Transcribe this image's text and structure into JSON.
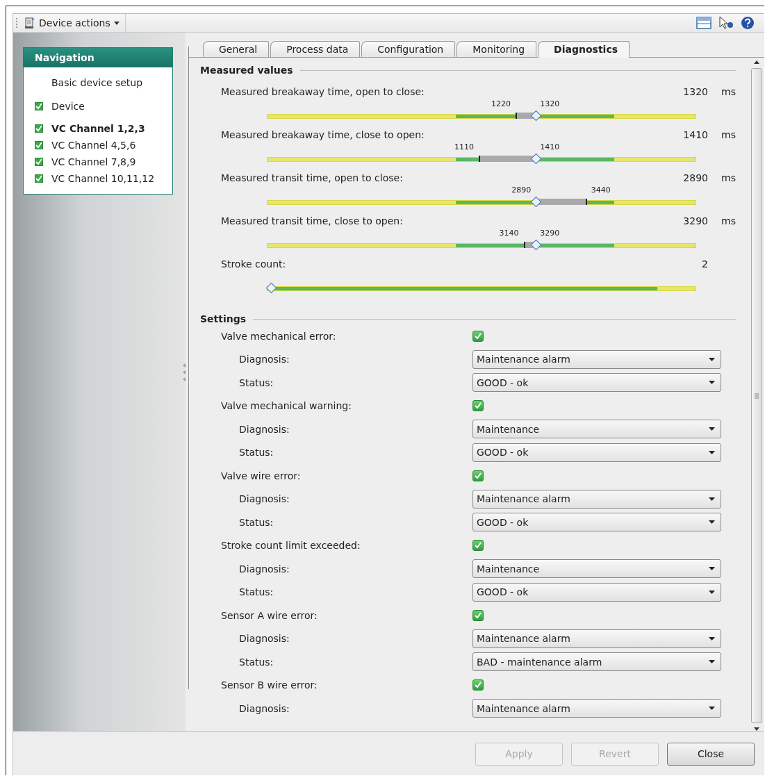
{
  "toolbar": {
    "device_actions": "Device actions"
  },
  "navigation": {
    "title": "Navigation",
    "items": [
      {
        "label": "Basic device setup",
        "kind": "plain",
        "selected": false
      },
      {
        "label": "Device",
        "kind": "check",
        "checked": true,
        "selected": false
      },
      {
        "label": "VC Channel 1,2,3",
        "kind": "check",
        "checked": true,
        "selected": true
      },
      {
        "label": "VC Channel 4,5,6",
        "kind": "check",
        "checked": true,
        "selected": false
      },
      {
        "label": "VC Channel 7,8,9",
        "kind": "check",
        "checked": true,
        "selected": false
      },
      {
        "label": "VC Channel 10,11,12",
        "kind": "check",
        "checked": true,
        "selected": false
      }
    ]
  },
  "tabs": [
    {
      "label": "General",
      "selected": false
    },
    {
      "label": "Process data",
      "selected": false
    },
    {
      "label": "Configuration",
      "selected": false
    },
    {
      "label": "Monitoring",
      "selected": false
    },
    {
      "label": "Diagnostics",
      "selected": true
    }
  ],
  "measured_values": {
    "title": "Measured values",
    "items": [
      {
        "kind": "range",
        "label": "Measured breakaway time, open to close:",
        "value": "1320",
        "unit": "ms",
        "level": 0.627,
        "range_from": "1220",
        "range_to": "1320"
      },
      {
        "kind": "range",
        "label": "Measured breakaway time, close to open:",
        "value": "1410",
        "unit": "ms",
        "level": 0.627,
        "range_from": "1110",
        "range_to": "1410"
      },
      {
        "kind": "range",
        "label": "Measured transit time, open to close:",
        "value": "2890",
        "unit": "ms",
        "level": 0.627,
        "range_from": "2890",
        "range_to": "3440"
      },
      {
        "kind": "range",
        "label": "Measured transit time, close to open:",
        "value": "3290",
        "unit": "ms",
        "level": 0.627,
        "range_from": "3140",
        "range_to": "3290"
      },
      {
        "kind": "count",
        "label": "Stroke count:",
        "value": "2",
        "level": 0
      }
    ]
  },
  "settings": {
    "title": "Settings",
    "items": [
      {
        "label": "Valve mechanical error:",
        "checked": true,
        "fields": [
          {
            "label": "Diagnosis:",
            "value": "Maintenance alarm"
          },
          {
            "label": "Status:",
            "value": "GOOD - ok"
          }
        ]
      },
      {
        "label": "Valve mechanical warning:",
        "checked": true,
        "fields": [
          {
            "label": "Diagnosis:",
            "value": "Maintenance"
          },
          {
            "label": "Status:",
            "value": "GOOD - ok"
          }
        ]
      },
      {
        "label": "Valve wire error:",
        "checked": true,
        "fields": [
          {
            "label": "Diagnosis:",
            "value": "Maintenance alarm"
          },
          {
            "label": "Status:",
            "value": "GOOD - ok"
          }
        ]
      },
      {
        "label": "Stroke count limit exceeded:",
        "checked": true,
        "fields": [
          {
            "label": "Diagnosis:",
            "value": "Maintenance"
          },
          {
            "label": "Status:",
            "value": "GOOD - ok"
          }
        ]
      },
      {
        "label": "Sensor A wire error:",
        "checked": true,
        "fields": [
          {
            "label": "Diagnosis:",
            "value": "Maintenance alarm"
          },
          {
            "label": "Status:",
            "value": "BAD - maintenance alarm"
          }
        ]
      },
      {
        "label": "Sensor B wire error:",
        "checked": true,
        "fields": [
          {
            "label": "Diagnosis:",
            "value": "Maintenance alarm"
          }
        ]
      }
    ]
  },
  "buttons": [
    {
      "label": "Apply",
      "disabled": true
    },
    {
      "label": "Revert",
      "disabled": true
    },
    {
      "label": "Close",
      "disabled": false
    }
  ]
}
